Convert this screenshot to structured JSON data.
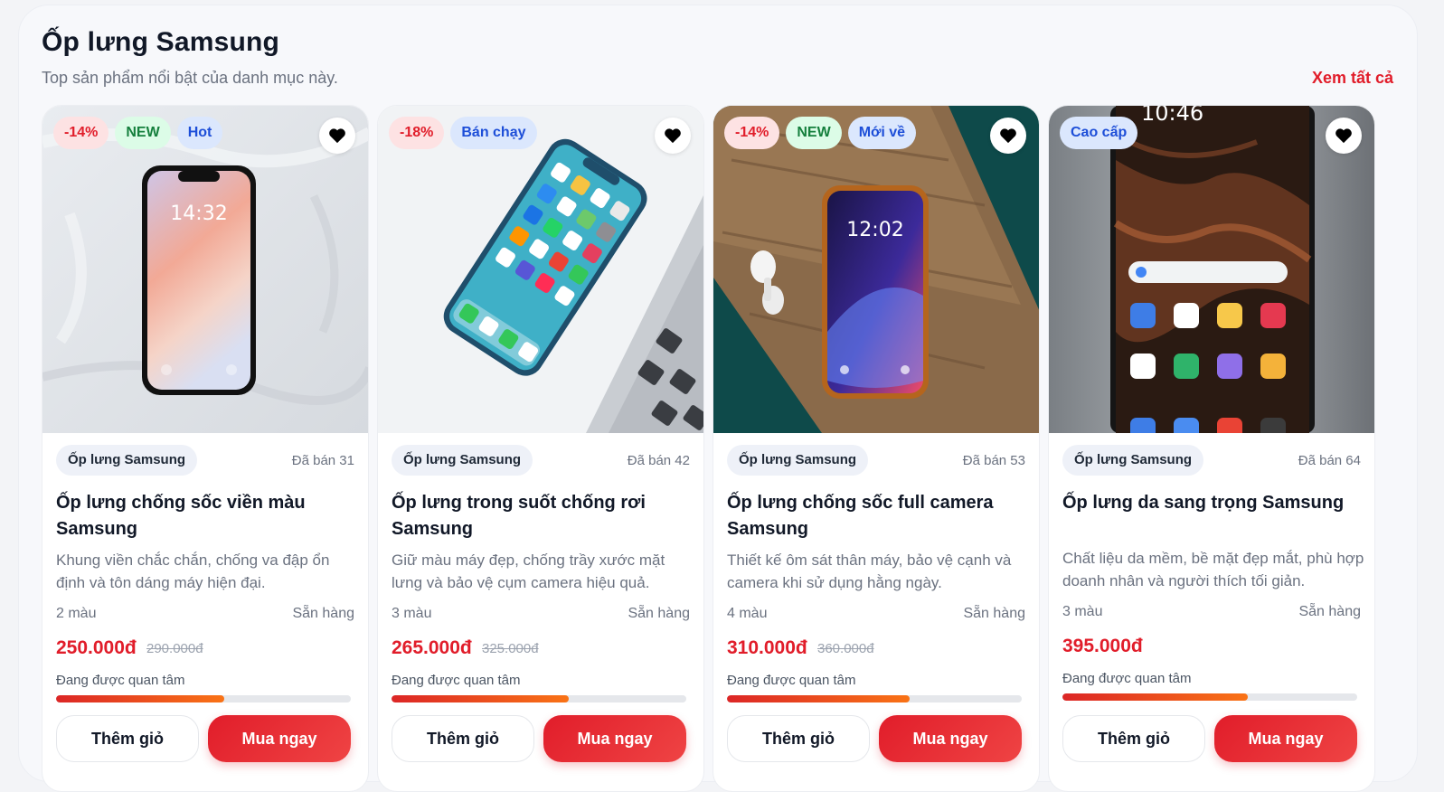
{
  "section": {
    "title": "Ốp lưng Samsung",
    "subtitle": "Top sản phẩm nổi bật của danh mục này.",
    "view_all": "Xem tất cả"
  },
  "products": [
    {
      "badges": [
        "-14%",
        "NEW",
        "Hot"
      ],
      "category": "Ốp lưng Samsung",
      "sold": "Đã bán 31",
      "title": "Ốp lưng chống sốc viền màu Samsung",
      "desc": "Khung viền chắc chắn, chống va đập ổn định và tôn dáng máy hiện đại.",
      "colors": "2 màu",
      "stock": "Sẵn hàng",
      "price": "250.000đ",
      "old_price": "290.000đ",
      "interest": "Đang được quan tâm",
      "interest_level": 0.57,
      "cart": "Thêm giỏ",
      "buy": "Mua ngay",
      "screen_time": "14:32"
    },
    {
      "badges": [
        "-18%",
        "Bán chạy"
      ],
      "category": "Ốp lưng Samsung",
      "sold": "Đã bán 42",
      "title": "Ốp lưng trong suốt chống rơi Samsung",
      "desc": "Giữ màu máy đẹp, chống trầy xước mặt lưng và bảo vệ cụm camera hiệu quả.",
      "colors": "3 màu",
      "stock": "Sẵn hàng",
      "price": "265.000đ",
      "old_price": "325.000đ",
      "interest": "Đang được quan tâm",
      "interest_level": 0.6,
      "cart": "Thêm giỏ",
      "buy": "Mua ngay"
    },
    {
      "badges": [
        "-14%",
        "NEW",
        "Mới về"
      ],
      "category": "Ốp lưng Samsung",
      "sold": "Đã bán 53",
      "title": "Ốp lưng chống sốc full camera Samsung",
      "desc": "Thiết kế ôm sát thân máy, bảo vệ cạnh và camera khi sử dụng hằng ngày.",
      "colors": "4 màu",
      "stock": "Sẵn hàng",
      "price": "310.000đ",
      "old_price": "360.000đ",
      "interest": "Đang được quan tâm",
      "interest_level": 0.62,
      "cart": "Thêm giỏ",
      "buy": "Mua ngay",
      "screen_time": "12:02"
    },
    {
      "badges": [
        "Cao cấp"
      ],
      "category": "Ốp lưng Samsung",
      "sold": "Đã bán 64",
      "title": "Ốp lưng da sang trọng Samsung",
      "desc": "Chất liệu da mềm, bề mặt đẹp mắt, phù hợp doanh nhân và người thích tối giản.",
      "colors": "3 màu",
      "stock": "Sẵn hàng",
      "price": "395.000đ",
      "old_price": "",
      "interest": "Đang được quan tâm",
      "interest_level": 0.63,
      "cart": "Thêm giỏ",
      "buy": "Mua ngay",
      "screen_time": "10:46"
    }
  ],
  "colors": {
    "accent": "#e11d2a",
    "sale_bg": "#fde2e3",
    "new_bg": "#dcfce7",
    "blue_bg": "#dbe7fd"
  }
}
